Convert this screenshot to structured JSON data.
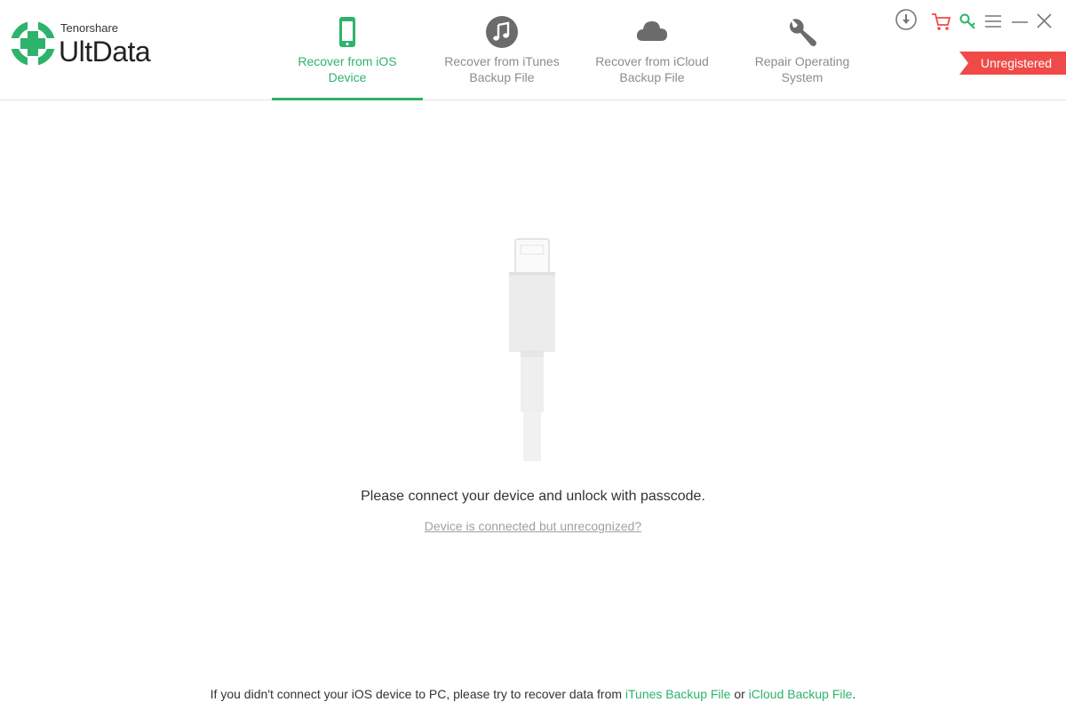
{
  "brand": {
    "company": "Tenorshare",
    "product": "UltData"
  },
  "tabs": [
    {
      "label": "Recover from iOS\nDevice",
      "icon": "phone-icon",
      "active": true
    },
    {
      "label": "Recover from iTunes\nBackup File",
      "icon": "music-note-icon",
      "active": false
    },
    {
      "label": "Recover from iCloud\nBackup File",
      "icon": "cloud-icon",
      "active": false
    },
    {
      "label": "Repair Operating\nSystem",
      "icon": "wrench-icon",
      "active": false
    }
  ],
  "window_controls": [
    "download-icon",
    "cart-icon",
    "key-icon",
    "menu-icon",
    "minimize-icon",
    "close-icon"
  ],
  "status_badge": "Unregistered",
  "main": {
    "prompt": "Please connect your device and unlock with passcode.",
    "help_link": "Device is connected but unrecognized?"
  },
  "footer": {
    "text_before": "If you didn't connect your iOS device to PC, please try to recover data from ",
    "itunes_link": "iTunes Backup File",
    "text_middle": " or ",
    "icloud_link": "iCloud Backup File",
    "text_after": "."
  },
  "colors": {
    "accent": "#2db36b",
    "badge": "#f04a48",
    "icon_gray": "#6b6b6b"
  }
}
